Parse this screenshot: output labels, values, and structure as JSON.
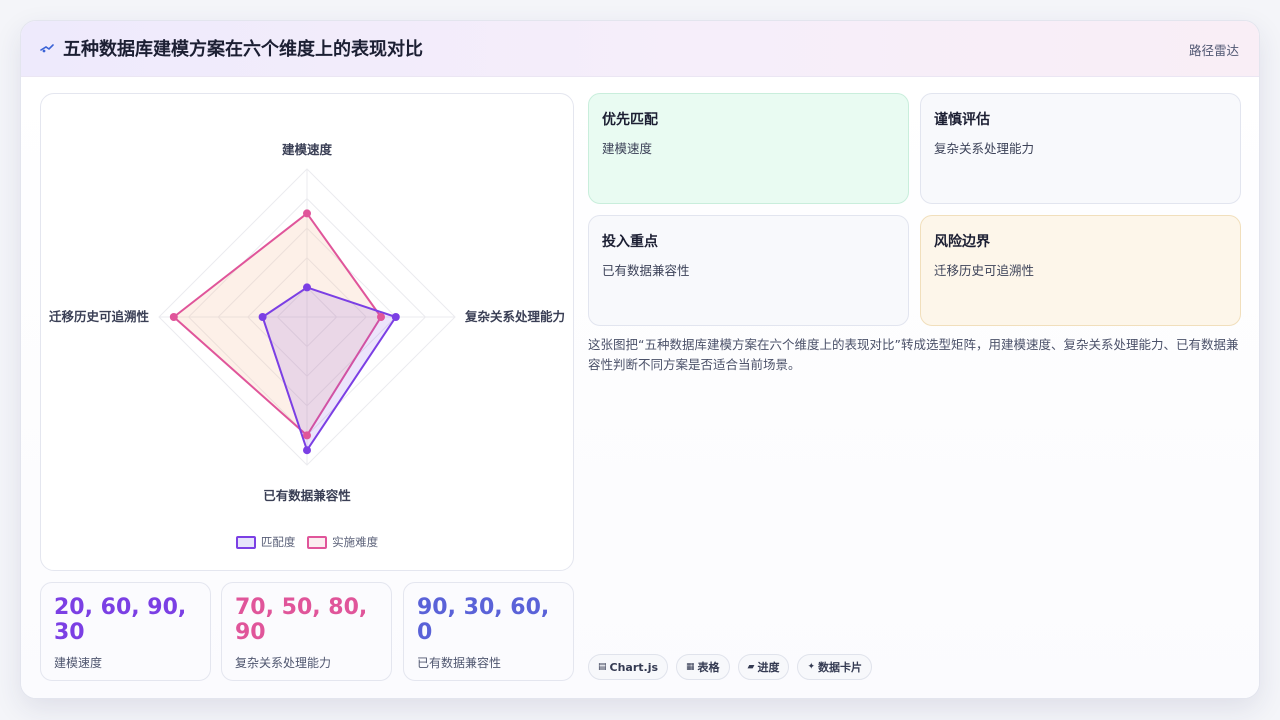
{
  "header": {
    "title": "五种数据库建模方案在六个维度上的表现对比",
    "tag": "路径雷达",
    "icon": "satellite-icon"
  },
  "chart_data": {
    "type": "radar",
    "axes": [
      "建模速度",
      "复杂关系处理能力",
      "已有数据兼容性",
      "迁移历史可追溯性"
    ],
    "series": [
      {
        "name": "匹配度",
        "values": [
          20,
          60,
          90,
          30
        ],
        "color": "#7b3fe4",
        "fill": "rgba(123,63,228,0.14)"
      },
      {
        "name": "实施难度",
        "values": [
          70,
          50,
          80,
          90
        ],
        "color": "#e0559a",
        "fill": "rgba(240,160,110,0.16)"
      }
    ],
    "range": [
      0,
      100
    ],
    "grid": true,
    "legend_position": "bottom"
  },
  "stats": [
    {
      "value": "20, 60, 90, 30",
      "label": "建模速度",
      "color": "#7b3fe4"
    },
    {
      "value": "70, 50, 80, 90",
      "label": "复杂关系处理能力",
      "color": "#e0559a"
    },
    {
      "value": "90, 30, 60, 0",
      "label": "已有数据兼容性",
      "color": "#5a62d8"
    }
  ],
  "cards": [
    {
      "title": "优先匹配",
      "sub": "建模速度"
    },
    {
      "title": "谨慎评估",
      "sub": "复杂关系处理能力"
    },
    {
      "title": "投入重点",
      "sub": "已有数据兼容性"
    },
    {
      "title": "风险边界",
      "sub": "迁移历史可追溯性"
    }
  ],
  "description": "这张图把“五种数据库建模方案在六个维度上的表现对比”转成选型矩阵，用建模速度、复杂关系处理能力、已有数据兼容性判断不同方案是否适合当前场景。",
  "chips": [
    {
      "icon": "▤",
      "label": "Chart.js"
    },
    {
      "icon": "▦",
      "label": "表格"
    },
    {
      "icon": "▰",
      "label": "进度"
    },
    {
      "icon": "✦",
      "label": "数据卡片"
    }
  ]
}
